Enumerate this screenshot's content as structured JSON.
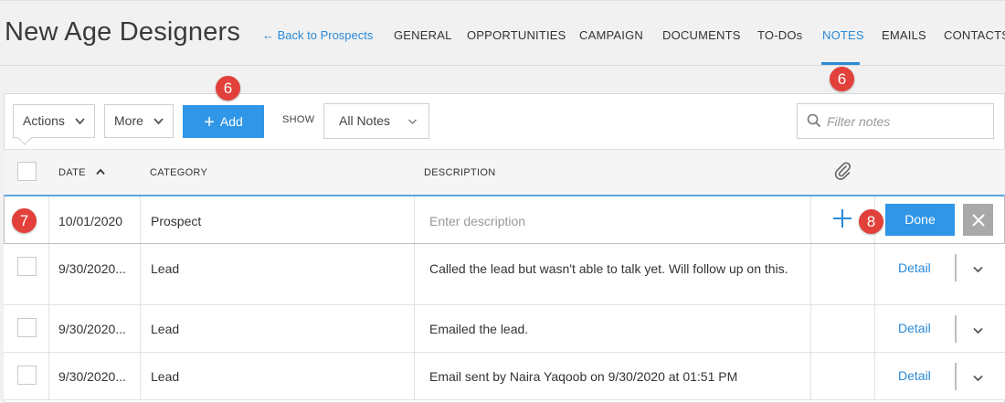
{
  "header": {
    "title": "New Age Designers",
    "back_link": "← Back to Prospects",
    "tabs": [
      "GENERAL",
      "OPPORTUNITIES",
      "CAMPAIGN",
      "DOCUMENTS",
      "TO-DOs",
      "NOTES",
      "EMAILS",
      "CONTACTS"
    ],
    "active_tab": "NOTES"
  },
  "badges": {
    "add": "6",
    "notes_tab": "6",
    "edit_row": "7",
    "plus": "8"
  },
  "toolbar": {
    "actions_label": "Actions",
    "more_label": "More",
    "add_label": "Add",
    "show_label": "SHOW",
    "show_value": "All Notes",
    "filter_placeholder": "Filter notes"
  },
  "table": {
    "headers": {
      "date": "DATE",
      "category": "CATEGORY",
      "description": "DESCRIPTION"
    },
    "edit_row": {
      "date": "10/01/2020",
      "category": "Prospect",
      "description_placeholder": "Enter description",
      "done_label": "Done"
    },
    "rows": [
      {
        "date": "9/30/2020...",
        "category": "Lead",
        "description": "Called the lead but wasn't able to talk yet. Will follow up on this.",
        "detail": "Detail"
      },
      {
        "date": "9/30/2020...",
        "category": "Lead",
        "description": "Emailed the lead.",
        "detail": "Detail"
      },
      {
        "date": "9/30/2020...",
        "category": "Lead",
        "description": "Email sent by Naira Yaqoob on 9/30/2020 at 01:51 PM",
        "detail": "Detail"
      }
    ]
  },
  "colors": {
    "accent": "#2a8ad8",
    "button": "#2f96e8",
    "badge": "#e2403a"
  }
}
